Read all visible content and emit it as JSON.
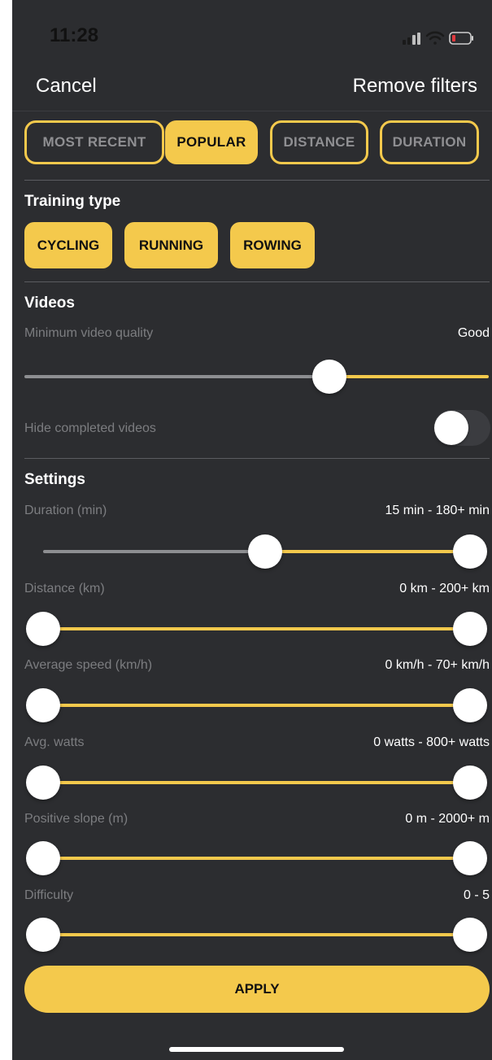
{
  "status_bar": {
    "time": "11:28"
  },
  "nav": {
    "cancel": "Cancel",
    "remove_filters": "Remove filters"
  },
  "sort_options": [
    {
      "label": "MOST RECENT",
      "active": false
    },
    {
      "label": "POPULAR",
      "active": true
    },
    {
      "label": "DISTANCE",
      "active": false
    },
    {
      "label": "DURATION",
      "active": false
    }
  ],
  "training_type": {
    "title": "Training type",
    "options": [
      "CYCLING",
      "RUNNING",
      "ROWING"
    ]
  },
  "videos": {
    "title": "Videos",
    "quality_label": "Minimum video quality",
    "quality_value": "Good",
    "quality_slider_fraction": 0.65,
    "hide_completed_label": "Hide completed videos",
    "hide_completed_on": false
  },
  "settings": {
    "title": "Settings",
    "sliders": [
      {
        "label": "Duration (min)",
        "value": "15 min - 180+ min",
        "low": 0.5,
        "high": 1.0
      },
      {
        "label": "Distance (km)",
        "value": "0 km - 200+ km",
        "low": 0.0,
        "high": 1.0
      },
      {
        "label": "Average speed (km/h)",
        "value": "0 km/h - 70+ km/h",
        "low": 0.0,
        "high": 1.0
      },
      {
        "label": "Avg. watts",
        "value": "0 watts - 800+ watts",
        "low": 0.0,
        "high": 1.0
      },
      {
        "label": "Positive slope (m)",
        "value": "0 m - 2000+ m",
        "low": 0.0,
        "high": 1.0
      },
      {
        "label": "Difficulty",
        "value": "0 - 5",
        "low": 0.0,
        "high": 1.0
      }
    ]
  },
  "apply_label": "APPLY",
  "colors": {
    "accent": "#f4c94c",
    "background": "#2c2d30"
  }
}
